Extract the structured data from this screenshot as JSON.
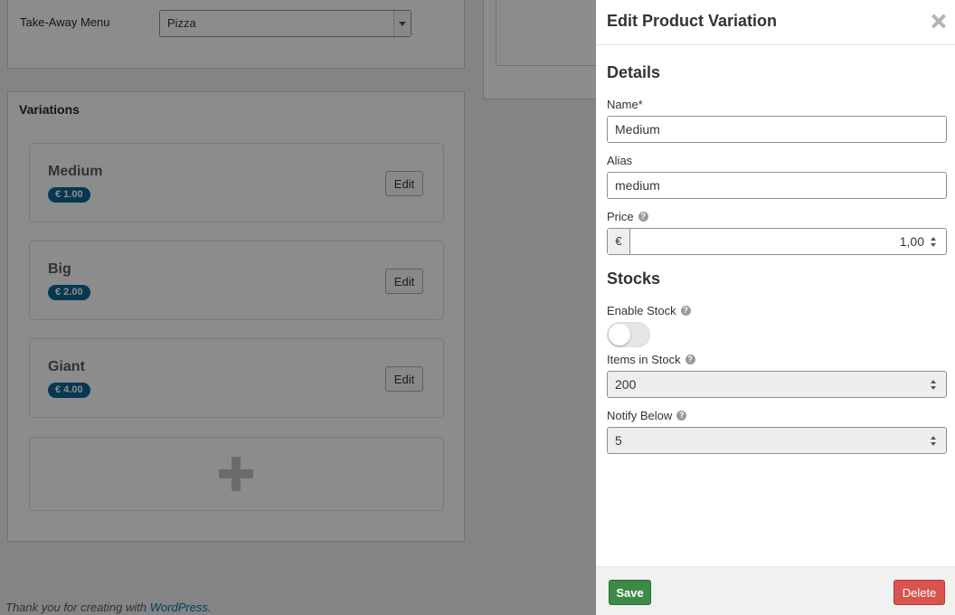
{
  "background": {
    "takeaway_label": "Take-Away Menu",
    "takeaway_value": "Pizza",
    "variations_title": "Variations",
    "variations": [
      {
        "name": "Medium",
        "price": "€ 1.00",
        "edit_label": "Edit"
      },
      {
        "name": "Big",
        "price": "€ 2.00",
        "edit_label": "Edit"
      },
      {
        "name": "Giant",
        "price": "€ 4.00",
        "edit_label": "Edit"
      }
    ],
    "footer_prefix": "Thank you for creating with ",
    "footer_link": "WordPress",
    "footer_suffix": "."
  },
  "panel": {
    "title": "Edit Product Variation",
    "details_title": "Details",
    "name_label": "Name*",
    "name_value": "Medium",
    "alias_label": "Alias",
    "alias_value": "medium",
    "price_label": "Price",
    "price_currency": "€",
    "price_value": "1,00",
    "stocks_title": "Stocks",
    "enable_stock_label": "Enable Stock",
    "enable_stock_on": false,
    "items_in_stock_label": "Items in Stock",
    "items_in_stock_value": "200",
    "notify_below_label": "Notify Below",
    "notify_below_value": "5",
    "help_glyph": "?",
    "save_label": "Save",
    "delete_label": "Delete"
  },
  "colors": {
    "save": "#3c8a45",
    "delete": "#d9534f",
    "price_badge": "#0b6694",
    "link": "#0073aa"
  },
  "icons": {
    "close": "close-icon",
    "help": "help-icon",
    "plus": "plus-icon",
    "spinner": "spin-icon",
    "dropdown": "chevron-down-icon"
  }
}
